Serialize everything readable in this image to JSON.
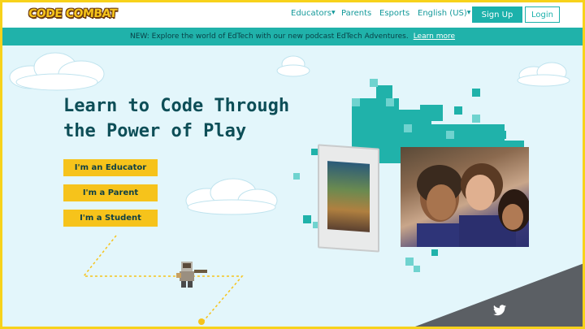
{
  "nav": {
    "logo_text": "CODE COMBAT",
    "educators": "Educators",
    "parents": "Parents",
    "esports": "Esports",
    "language": "English (US)",
    "signup": "Sign Up",
    "login": "Login"
  },
  "banner": {
    "text": "NEW: Explore the world of EdTech with our new podcast EdTech Adventures.",
    "link": "Learn more"
  },
  "hero": {
    "title_line1": "Learn to Code Through",
    "title_line2": "the Power of Play"
  },
  "roles": {
    "educator": "I'm an Educator",
    "parent": "I'm a Parent",
    "student": "I'm a Student"
  },
  "colors": {
    "frame": "#f7d21b",
    "teal": "#20b2aa",
    "button_yellow": "#f6c31b",
    "title": "#0d4e57",
    "background": "#e3f6fb"
  },
  "icons": [
    "twitter-icon",
    "caret-down-icon",
    "cloud-icon",
    "hero-character-icon"
  ]
}
